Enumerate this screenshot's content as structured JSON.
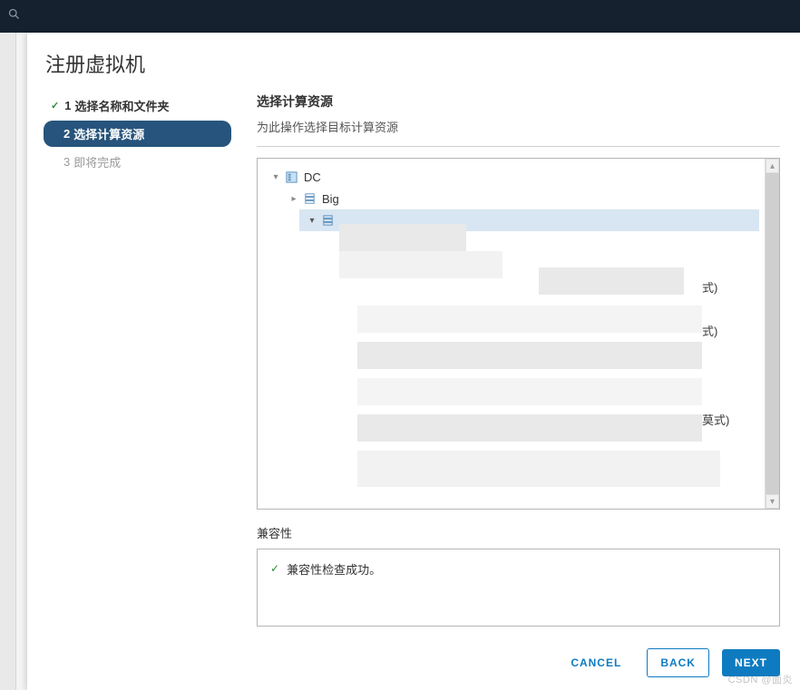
{
  "modal": {
    "title": "注册虚拟机"
  },
  "steps": [
    {
      "num": "1",
      "label": "选择名称和文件夹",
      "state": "done"
    },
    {
      "num": "2",
      "label": "选择计算资源",
      "state": "active"
    },
    {
      "num": "3",
      "label": "即将完成",
      "state": "pending"
    }
  ],
  "content": {
    "heading": "选择计算资源",
    "subheading": "为此操作选择目标计算资源"
  },
  "tree": {
    "root": {
      "label": "DC",
      "expanded": true
    },
    "children": [
      {
        "label": "Big",
        "expanded": false
      },
      {
        "label": "",
        "expanded": true,
        "selected": true,
        "obscured": true
      }
    ],
    "obscured_suffixes": [
      "式)",
      "式)",
      "莫式)"
    ]
  },
  "compat": {
    "section_label": "兼容性",
    "status_text": "兼容性检查成功。"
  },
  "footer": {
    "cancel": "CANCEL",
    "back": "BACK",
    "next": "NEXT"
  },
  "watermark": "CSDN @面炎",
  "icons": {
    "datacenter": "datacenter-icon",
    "cluster": "cluster-icon",
    "search": "search-icon"
  }
}
